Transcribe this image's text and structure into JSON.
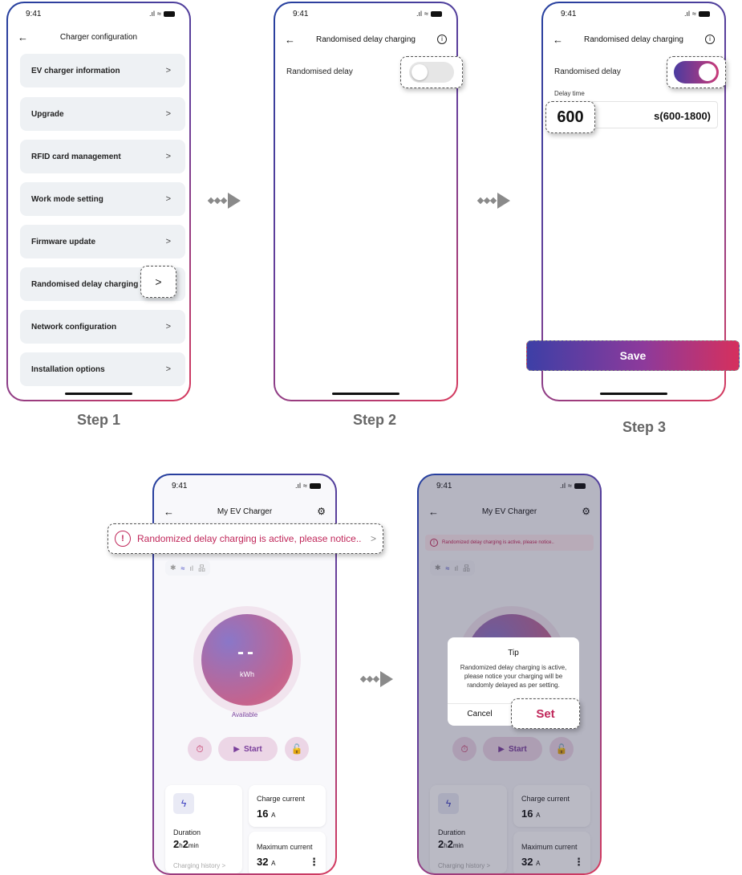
{
  "status_time": "9:41",
  "steps": {
    "s1": "Step 1",
    "s2": "Step 2",
    "s3": "Step 3"
  },
  "screen1": {
    "title": "Charger configuration",
    "items": [
      "EV charger information",
      "Upgrade",
      "RFID card management",
      "Work mode setting",
      "Firmware update",
      "Randomised delay charging",
      "Network configuration",
      "Installation options"
    ],
    "chevron": ">"
  },
  "screen2": {
    "title": "Randomised delay charging",
    "toggle_label": "Randomised delay",
    "toggle_on": false
  },
  "screen3": {
    "title": "Randomised delay charging",
    "toggle_label": "Randomised delay",
    "toggle_on": true,
    "delay_label": "Delay time",
    "delay_value": "600",
    "delay_unit": "s(600-1800)",
    "save_label": "Save"
  },
  "screen4": {
    "title": "My EV Charger",
    "notice_icon": "!",
    "notice_text": "Randomized delay charging is active, please notice..",
    "notice_chevron": ">",
    "gauge_value": "--",
    "gauge_unit": "kWh",
    "state": "Available",
    "start_label": "Start",
    "duration_label": "Duration",
    "duration_h": "2",
    "duration_h_unit": "h",
    "duration_m": "2",
    "duration_m_unit": "min",
    "history_label": "Charging history >",
    "charge_current_label": "Charge current",
    "charge_current_value": "16",
    "current_unit": "A",
    "max_current_label": "Maximum current",
    "max_current_value": "32",
    "more_icon": "⋮"
  },
  "screen5": {
    "title": "My EV Charger",
    "notice_text": "Randomized delay charging is active, please notice..",
    "tip_title": "Tip",
    "tip_body": "Randomized delay charging is active, please notice your charging will be randomly delayed as per setting.",
    "cancel_label": "Cancel",
    "set_label": "Set"
  },
  "colors": {
    "accent": "#c0275a",
    "brand_blue": "#2b4fa3",
    "purple": "#7a3f9b"
  }
}
